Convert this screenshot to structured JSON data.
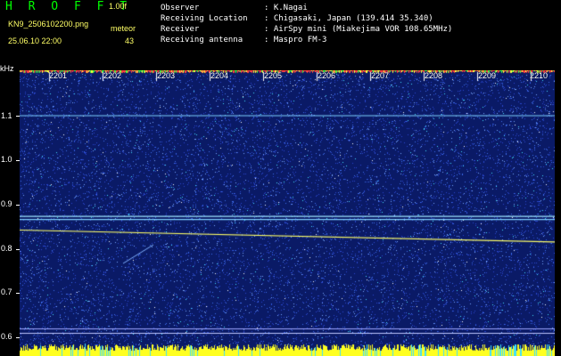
{
  "header": {
    "app_title": "H R O F F T",
    "version": "1.00f",
    "file_name": "KN9_2506102200.png",
    "datetime": "25.06.10 22:00",
    "meteor_label": "meteor",
    "meteor_count": "43"
  },
  "info": {
    "rows": [
      {
        "key": "Observer",
        "value": "K.Nagai"
      },
      {
        "key": "Receiving Location",
        "value": "Chigasaki, Japan (139.414 35.340)"
      },
      {
        "key": "Receiver",
        "value": "AirSpy mini (Miakejima VOR 108.65MHz)"
      },
      {
        "key": "Receiving antenna",
        "value": "Maspro FM-3"
      }
    ]
  },
  "spectrogram": {
    "y_unit": "kHz",
    "y_ticks": [
      "1.1",
      "1.0",
      "0.9",
      "0.8",
      "0.7",
      "0.6"
    ],
    "y_tick_values": [
      1.1,
      1.0,
      0.9,
      0.8,
      0.7,
      0.6
    ],
    "y_range": [
      0.595,
      1.2
    ],
    "x_ticks": [
      "2201",
      "2202",
      "2203",
      "2204",
      "2205",
      "2206",
      "2207",
      "2208",
      "2209",
      "2210"
    ],
    "background_color": "#0a1a66",
    "noise_colors": [
      "#2a48d0",
      "#3f6ff0",
      "#79a8ff",
      "#ffffff",
      "#44e0ff"
    ],
    "carrier_lines": [
      {
        "freq_start": 1.1,
        "freq_end": 1.1,
        "color": "#7fd0ff"
      },
      {
        "freq_start": 0.873,
        "freq_end": 0.873,
        "color": "#9fe8ff"
      },
      {
        "freq_start": 0.866,
        "freq_end": 0.866,
        "color": "#7fd0ff"
      },
      {
        "freq_start": 0.842,
        "freq_end": 0.815,
        "color": "#ffff66"
      }
    ],
    "bottom_lines": [
      {
        "freq": 0.62,
        "color": "#a0a8ff"
      },
      {
        "freq": 0.61,
        "color": "#c0c8ff"
      }
    ]
  }
}
